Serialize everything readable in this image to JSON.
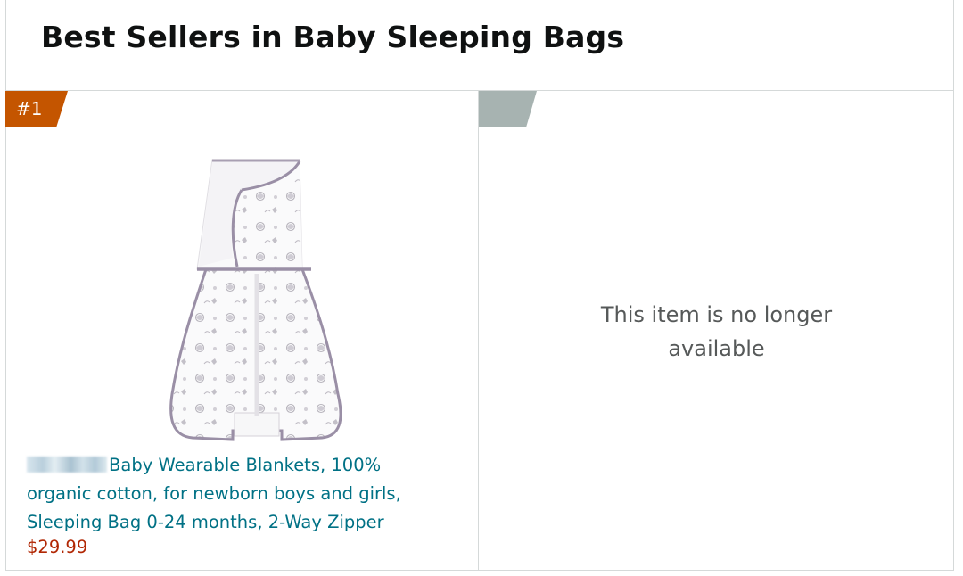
{
  "page": {
    "title": "Best Sellers in Baby Sleeping Bags"
  },
  "items": [
    {
      "rank": "#1",
      "title": "Baby Wearable Blankets, 100% organic cotton, for newborn boys and girls, Sleeping Bag 0-24 months, 2-Way Zipper",
      "price": "$29.99",
      "image_icon": "swaddle-sleep-sack-image"
    },
    {
      "rank": "",
      "unavailable_line1": "This item is no longer",
      "unavailable_line2": "available"
    }
  ],
  "colors": {
    "rank_badge": "#c45500",
    "rank_badge_empty": "#a7b3b1",
    "link": "#007185",
    "price": "#b12704",
    "muted_text": "#565959",
    "border": "#d5d9d9"
  }
}
